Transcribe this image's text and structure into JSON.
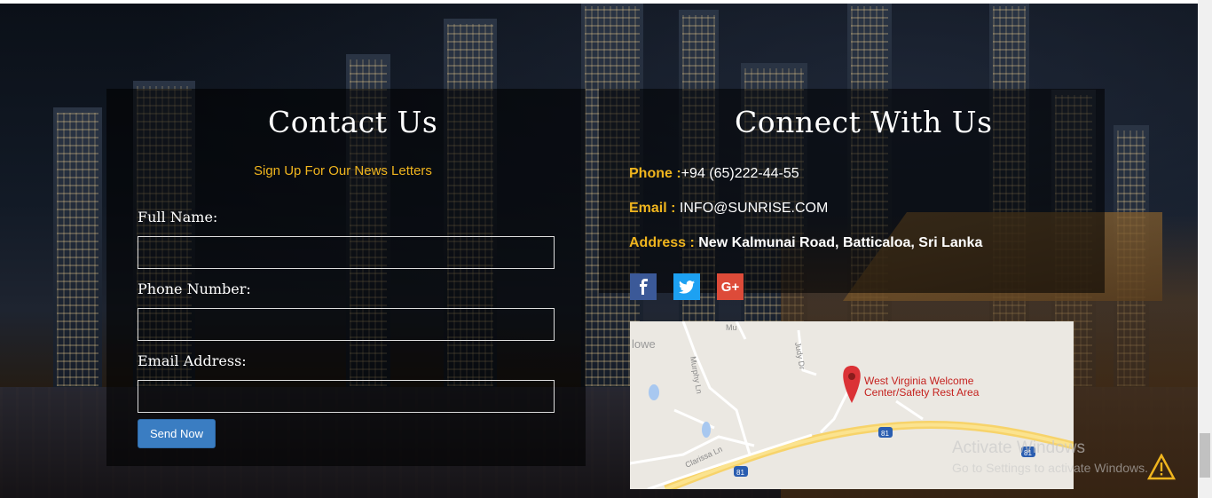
{
  "contact": {
    "title": "Contact Us",
    "subtitle": "Sign Up For Our News Letters",
    "fields": [
      {
        "label": "Full Name:",
        "value": ""
      },
      {
        "label": "Phone Number:",
        "value": ""
      },
      {
        "label": "Email Address:",
        "value": ""
      }
    ],
    "submit_label": "Send Now"
  },
  "connect": {
    "title": "Connect With Us",
    "phone_label": "Phone :",
    "phone_value": "+94 (65)222-44-55",
    "email_label": "Email :",
    "email_value": "INFO@SUNRISE.COM",
    "address_label": "Address :",
    "address_value": "New Kalmunai Road, Batticaloa, Sri Lanka",
    "social": [
      {
        "name": "facebook-icon",
        "glyph": "f",
        "color": "#3b5998"
      },
      {
        "name": "twitter-icon",
        "glyph": "t",
        "color": "#1da1f2"
      },
      {
        "name": "google-plus-icon",
        "glyph": "G+",
        "color": "#dd4b39"
      }
    ]
  },
  "map": {
    "place_line1": "West Virginia Welcome",
    "place_line2": "Center/Safety Rest Area",
    "road_labels": [
      "Murphy Ln",
      "Judy Dr",
      "Clarissa Ln",
      "Mu",
      "lowe"
    ],
    "shields": [
      "81",
      "81",
      "81"
    ]
  },
  "windows_notice": {
    "line1": "Activate Windows",
    "line2": "Go to Settings to activate Windows."
  },
  "colors": {
    "accent": "#f0b51e",
    "button": "#3a7dc2"
  }
}
